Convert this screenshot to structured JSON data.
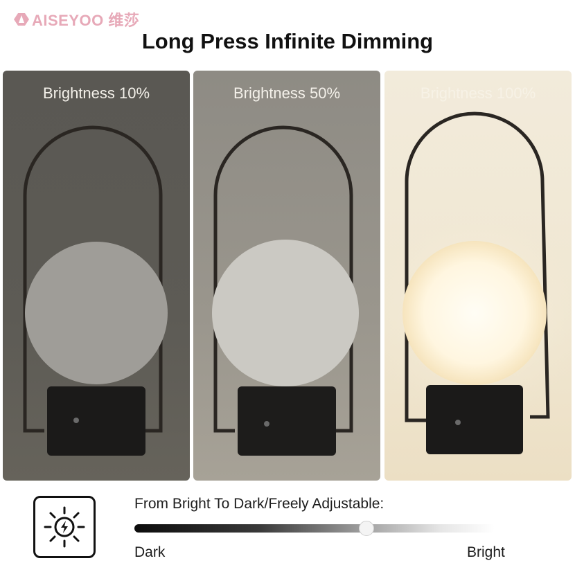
{
  "brand": {
    "logo_text": "AISEYOO 维莎",
    "accent": "#e7a9b8"
  },
  "title": "Long Press Infinite Dimming",
  "panels": [
    {
      "label": "Brightness 10%",
      "brightness": 0.1
    },
    {
      "label": "Brightness 50%",
      "brightness": 0.5
    },
    {
      "label": "Brightness 100%",
      "brightness": 1.0
    }
  ],
  "dimmer": {
    "icon": "touch-dimmer-sun-icon",
    "caption": "From Bright To Dark/Freely Adjustable:",
    "left_label": "Dark",
    "right_label": "Bright",
    "thumb_position": 0.645
  }
}
